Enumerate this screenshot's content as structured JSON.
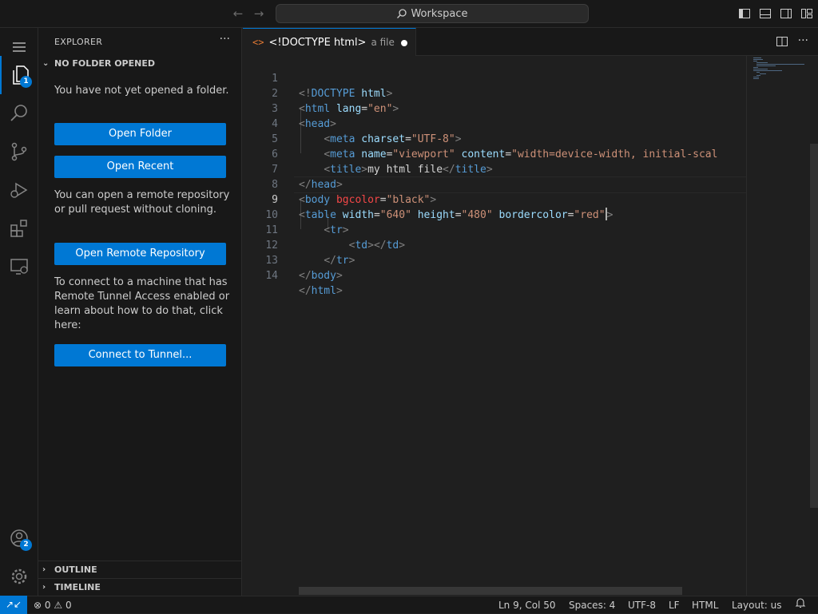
{
  "titlebar": {
    "search": "Workspace"
  },
  "activity": {
    "explorer_badge": "1",
    "accounts_badge": "2"
  },
  "sidebar": {
    "title": "EXPLORER",
    "section": "NO FOLDER OPENED",
    "msg1": "You have not yet opened a folder.",
    "open_folder": "Open Folder",
    "open_recent": "Open Recent",
    "msg2": "You can open a remote repository or pull request without cloning.",
    "open_remote": "Open Remote Repository",
    "msg3": "To connect to a machine that has Remote Tunnel Access enabled or learn about how to do that, click here:",
    "connect_tunnel": "Connect to Tunnel...",
    "outline": "OUTLINE",
    "timeline": "TIMELINE"
  },
  "tab": {
    "icon": "<>",
    "title": "<!DOCTYPE html>",
    "desc": "a file"
  },
  "code": {
    "line_numbers": [
      "1",
      "2",
      "3",
      "4",
      "5",
      "6",
      "7",
      "8",
      "9",
      "10",
      "11",
      "12",
      "13",
      "14"
    ],
    "l1": {
      "lt": "<!",
      "tag": "DOCTYPE",
      "attr": "html",
      "gt": ">"
    },
    "l2": {
      "lt": "<",
      "tag": "html",
      "attr": "lang",
      "eq": "=",
      "val": "\"en\"",
      "gt": ">"
    },
    "l3": {
      "lt": "<",
      "tag": "head",
      "gt": ">"
    },
    "l4": {
      "lt": "<",
      "tag": "meta",
      "attr": "charset",
      "eq": "=",
      "val": "\"UTF-8\"",
      "gt": ">"
    },
    "l5": {
      "lt": "<",
      "tag": "meta",
      "attr1": "name",
      "eq1": "=",
      "val1": "\"viewport\"",
      "attr2": "content",
      "eq2": "=",
      "val2": "\"width=device-width, initial-scal"
    },
    "l6": {
      "lt": "<",
      "tag": "title",
      "gt": ">",
      "text": "my html file",
      "lt2": "</",
      "tag2": "title",
      "gt2": ">"
    },
    "l7": {
      "lt": "</",
      "tag": "head",
      "gt": ">"
    },
    "l8": {
      "lt": "<",
      "tag": "body",
      "attr": "bgcolor",
      "eq": "=",
      "val": "\"black\"",
      "gt": ">"
    },
    "l9": {
      "lt": "<",
      "tag": "table",
      "attr1": "width",
      "eq1": "=",
      "val1": "\"640\"",
      "attr2": "height",
      "eq2": "=",
      "val2": "\"480\"",
      "attr3": "bordercolor",
      "eq3": "=",
      "val3": "\"red\"",
      "gt": ">"
    },
    "l10": {
      "lt": "<",
      "tag": "tr",
      "gt": ">"
    },
    "l11": {
      "lt": "<",
      "tag": "td",
      "gt": ">",
      "lt2": "</",
      "tag2": "td",
      "gt2": ">"
    },
    "l12": {
      "lt": "</",
      "tag": "tr",
      "gt": ">"
    },
    "l13": {
      "lt": "</",
      "tag": "body",
      "gt": ">"
    },
    "l14": {
      "lt": "</",
      "tag": "html",
      "gt": ">"
    }
  },
  "status": {
    "errors": "0",
    "warnings": "0",
    "position": "Ln 9, Col 50",
    "spaces": "Spaces: 4",
    "encoding": "UTF-8",
    "eol": "LF",
    "language": "HTML",
    "layout": "Layout: us"
  }
}
